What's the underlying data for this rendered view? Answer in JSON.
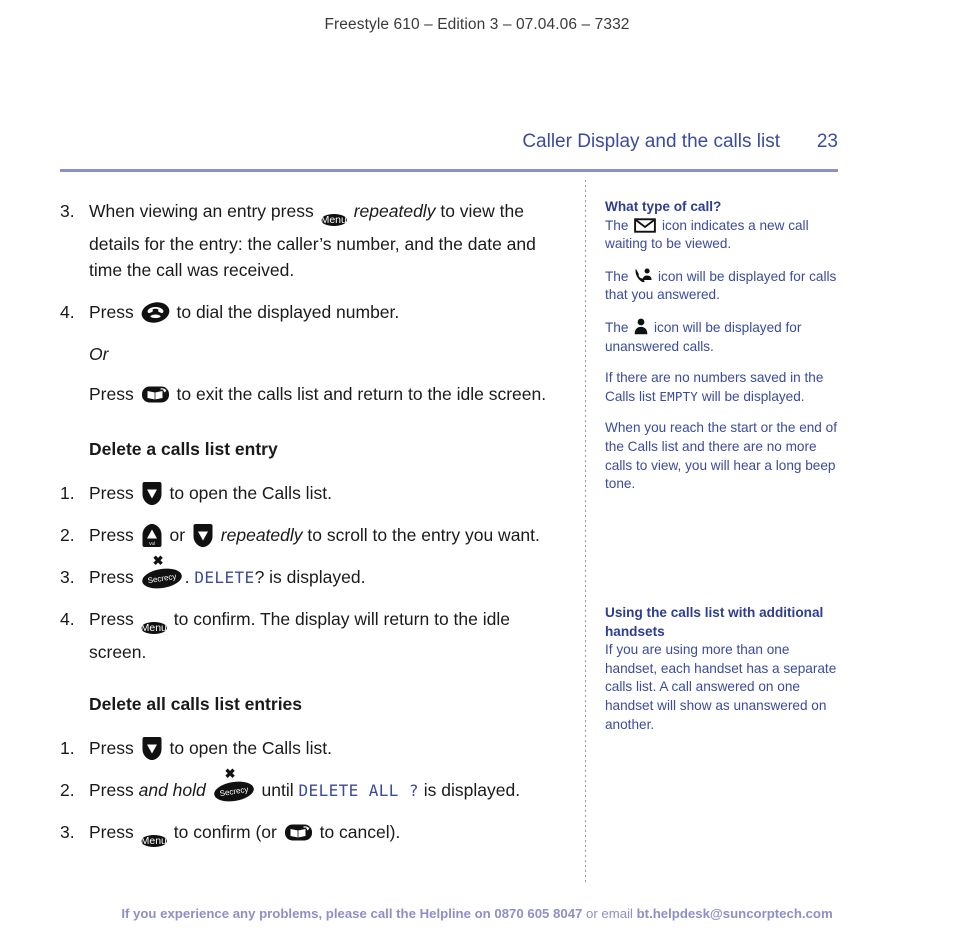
{
  "running_head": "Freestyle 610 – Edition 3 – 07.04.06 – 7332",
  "header": {
    "section_title": "Caller Display and the calls list",
    "page_number": "23",
    "accent_color": "#3b4b9e",
    "rule_color": "#8d90c6"
  },
  "main": {
    "steps": [
      {
        "num": "3.",
        "text_before": "When viewing an entry press",
        "icon": "menu-key-icon",
        "icon_label": "Menu",
        "text_italic": "repeatedly",
        "text_after": "to view the details for the entry: the caller’s number, and the date and time the call was received."
      },
      {
        "num": "4.",
        "text_before": "Press",
        "icon": "dial-key-icon",
        "text_after": "to dial the displayed number."
      }
    ],
    "or_label": "Or",
    "exit_para": {
      "text_before": "Press",
      "icon": "phonebook-key-icon",
      "text_after": "to exit the calls list and return to the idle screen."
    },
    "section_delete_entry": {
      "heading": "Delete a calls list entry",
      "steps": [
        {
          "num": "1.",
          "text_before": "Press",
          "icon": "down-arrow-key-icon",
          "text_after": "to open the Calls list."
        },
        {
          "num": "2.",
          "text_before": "Press",
          "icon_up": "up-arrow-volume-key-icon",
          "icon_up_label": "Vol",
          "text_mid": "or",
          "icon_down": "down-arrow-key-icon",
          "text_italic": "repeatedly",
          "text_after": "to scroll to the entry you want."
        },
        {
          "num": "3.",
          "text_before": "Press",
          "icon": "secrecy-key-icon",
          "icon_label": "Secrecy",
          "text_dot": ".",
          "lcd_text": "DELETE",
          "text_after": "?  is displayed."
        },
        {
          "num": "4.",
          "text_before": "Press",
          "icon": "menu-key-icon",
          "icon_label": "Menu",
          "text_after": "to confirm. The display will return to the idle screen."
        }
      ]
    },
    "section_delete_all": {
      "heading": "Delete all calls list entries",
      "steps": [
        {
          "num": "1.",
          "text_before": "Press",
          "icon": "down-arrow-key-icon",
          "text_after": "to open the Calls list."
        },
        {
          "num": "2.",
          "text_before": "Press",
          "text_italic": "and hold",
          "icon": "secrecy-key-icon",
          "icon_label": "Secrecy",
          "text_mid": "until",
          "lcd_text": "DELETE ALL ?",
          "text_after": "is displayed."
        },
        {
          "num": "3.",
          "text_before": "Press",
          "icon": "menu-key-icon",
          "icon_label": "Menu",
          "text_mid": "to confirm (or",
          "icon_cancel": "phonebook-key-icon",
          "text_after": "to cancel)."
        }
      ]
    }
  },
  "sidebar": {
    "block1": {
      "heading": "What type of call?",
      "paras": [
        {
          "text_before": "The",
          "icon": "envelope-icon",
          "text_after": "icon indicates a new call waiting to be viewed."
        },
        {
          "text_before": "The",
          "icon": "answered-call-icon",
          "text_after": "icon will be displayed for calls that you answered."
        },
        {
          "text_before": "The",
          "icon": "person-icon",
          "text_after": "icon will be displayed for unanswered calls."
        },
        {
          "text_before": "If there are no numbers saved in the Calls list",
          "lcd_text": "EMPTY",
          "text_after": "will be displayed."
        },
        {
          "text_full": "When you reach the start or the end of the Calls list and there are no more calls to view, you will hear a long beep tone."
        }
      ]
    },
    "block2": {
      "heading": "Using the calls list with additional handsets",
      "body": "If you are using more than one handset, each handset has a separate calls list. A call answered on one handset will show as unanswered on another."
    }
  },
  "footer": {
    "text_before": "If you experience any problems, please call the Helpline on",
    "phone": "0870 605 8047",
    "text_mid": "or email",
    "email": "bt.helpdesk@suncorptech.com",
    "color": "#8d90c6"
  }
}
